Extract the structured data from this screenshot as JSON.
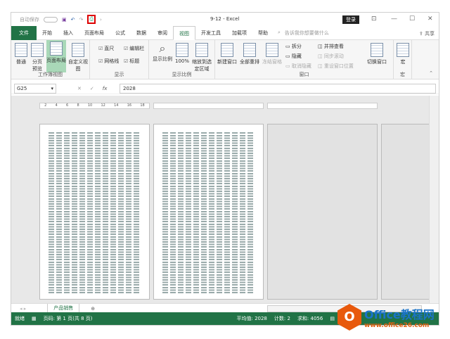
{
  "title": {
    "autosave": "自动保存",
    "autosave_state": "关",
    "doc": "9-12 - Excel",
    "login": "登录"
  },
  "tabs": [
    "文件",
    "开始",
    "插入",
    "页面布局",
    "公式",
    "数据",
    "审阅",
    "视图",
    "开发工具",
    "加载项",
    "帮助"
  ],
  "search_placeholder": "告诉我你想要做什么",
  "share": "共享",
  "ribbon": {
    "views": {
      "label": "工作簿视图",
      "normal": "普通",
      "pagebreak": "分页预览",
      "layout": "页面布局",
      "custom": "自定义视图"
    },
    "show": {
      "label": "显示",
      "ruler": "直尺",
      "formula_bar": "编辑栏",
      "gridlines": "网格线",
      "headings": "标题"
    },
    "zoom": {
      "label": "显示比例",
      "zoom": "显示比例",
      "hundred": "100%",
      "selection": "缩放到选定区域"
    },
    "window": {
      "label": "窗口",
      "new": "新建窗口",
      "arrange": "全部重排",
      "freeze": "冻结窗格",
      "split": "拆分",
      "hide": "隐藏",
      "unhide": "取消隐藏",
      "side": "并排查看",
      "sync": "同步滚动",
      "reset": "重设窗口位置",
      "switch": "切换窗口"
    },
    "macros": {
      "label": "宏",
      "macro": "宏"
    }
  },
  "formula": {
    "cell": "G25",
    "value": "2028",
    "fx": "fx"
  },
  "ruler_ticks": [
    "2",
    "4",
    "6",
    "8",
    "10",
    "12",
    "14",
    "16",
    "18"
  ],
  "sheet": {
    "tab": "产品销售"
  },
  "status": {
    "ready": "就绪",
    "page": "页码: 第 1 页(共 8 页)",
    "average": "平均值: 2028",
    "count": "计数: 2",
    "sum": "求和: 4056"
  },
  "watermark": {
    "brand": "Office教程网",
    "url": "www.office26.com"
  }
}
